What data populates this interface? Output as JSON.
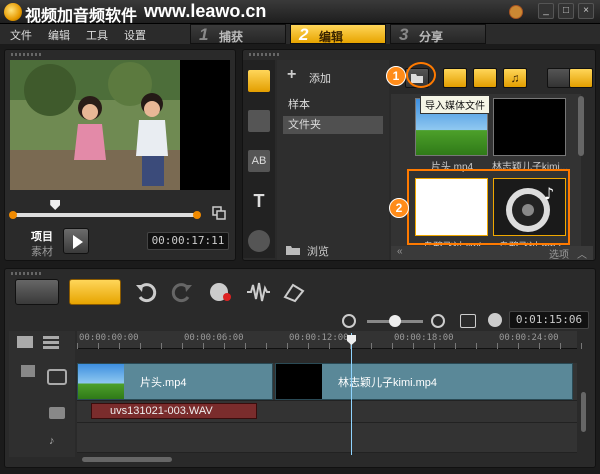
{
  "app": {
    "title": "视频加音频软件",
    "watermark": "www.leawo.cn"
  },
  "menu": [
    "文件",
    "编辑",
    "工具",
    "设置"
  ],
  "steps": [
    {
      "num": "1",
      "label": "捕获",
      "active": false
    },
    {
      "num": "2",
      "label": "编辑",
      "active": true
    },
    {
      "num": "3",
      "label": "分享",
      "active": false
    }
  ],
  "player": {
    "mode_project": "项目",
    "mode_clip": "素材",
    "timecode": "00:00:17:11",
    "scrub_position": 0.2
  },
  "library": {
    "add_label": "添加",
    "folders": [
      {
        "label": "样本",
        "selected": false
      },
      {
        "label": "文件夹",
        "selected": true
      }
    ],
    "browse_label": "浏览",
    "tooltip": "导入媒体文件",
    "options_label": "选项",
    "media": [
      {
        "name": "片头.mp4",
        "thumb": "landscape"
      },
      {
        "name": "林志颖儿子kimi...",
        "thumb": "black"
      },
      {
        "name": "乌鸦飞过.swf",
        "thumb": "white"
      },
      {
        "name": "乌鸦飞过.mp3",
        "thumb": "audio"
      }
    ]
  },
  "callouts": [
    "1",
    "2"
  ],
  "timeline": {
    "timecode": "0:01:15:06",
    "ruler": [
      "00:00:00:00",
      "00:00:06:00",
      "00:00:12:00",
      "00:00:18:00",
      "00:00:24:00"
    ],
    "video_clips": [
      {
        "label": "片头.mp4"
      },
      {
        "label": "林志颖儿子kimi.mp4"
      }
    ],
    "audio_clip": "uvs131021-003.WAV",
    "accent": "#f0a800"
  }
}
